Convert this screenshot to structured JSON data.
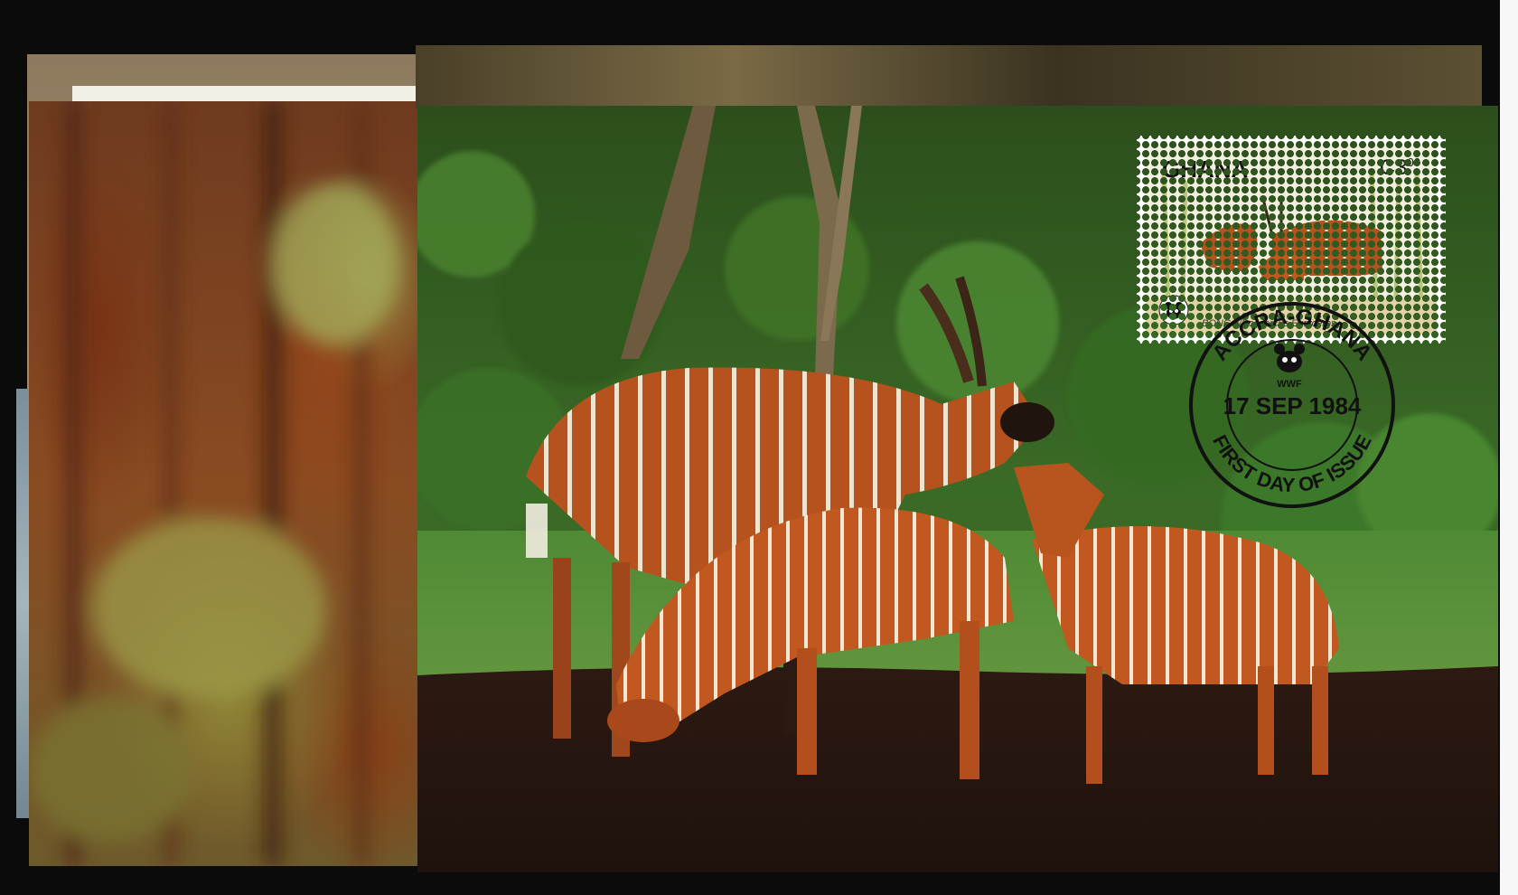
{
  "stamp": {
    "country": "GHANA",
    "value": "C3",
    "value_cents": "00",
    "caption": "BONGO/Boocercus Euryceros",
    "logo": "WWF"
  },
  "postmark": {
    "place": "ACCRA-GHANA",
    "date": "17 SEP 1984",
    "label": "FIRST DAY OF ISSUE",
    "logo": "WWF"
  },
  "icons": [
    "panda-logo-icon",
    "postmark-panda-icon"
  ],
  "colors": {
    "background": "#0b0b0b",
    "foliage": "#2f5a1f",
    "bongo_coat": "#b5521d",
    "ground": "#2a1a12"
  }
}
